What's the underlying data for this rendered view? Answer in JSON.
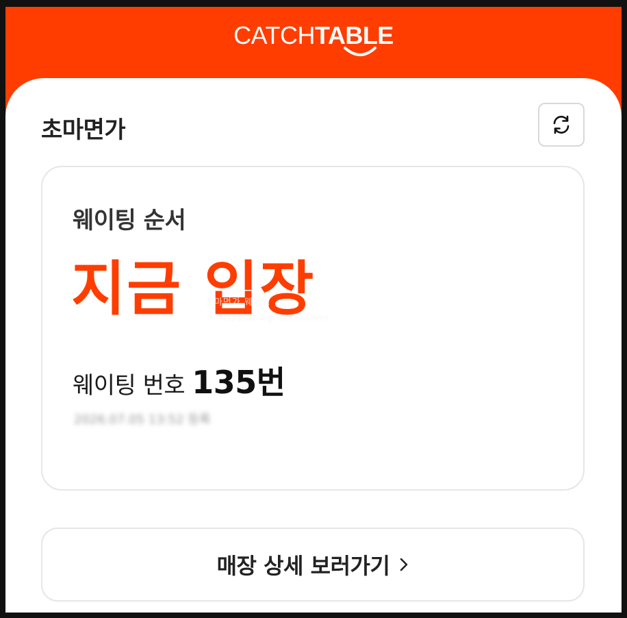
{
  "header": {
    "brand_thin": "CATCH",
    "brand_bold": "TABLE",
    "background_color": "#ff3d00"
  },
  "store": {
    "name": "초마면가",
    "refresh_icon": "refresh-icon"
  },
  "waiting_card": {
    "label": "웨이팅 순서",
    "status": "지금 입장",
    "status_color": "#ff3d00",
    "number_label": "웨이팅 번호",
    "number_value": "135번",
    "registered_text": "2026.07.05 13:52 등록"
  },
  "watermark": {
    "line1": "초마면가 웨이팅",
    "line2": "https://blog.naver.com/"
  },
  "store_link": {
    "label": "매장 상세 보러가기",
    "icon": "chevron-right-icon"
  }
}
